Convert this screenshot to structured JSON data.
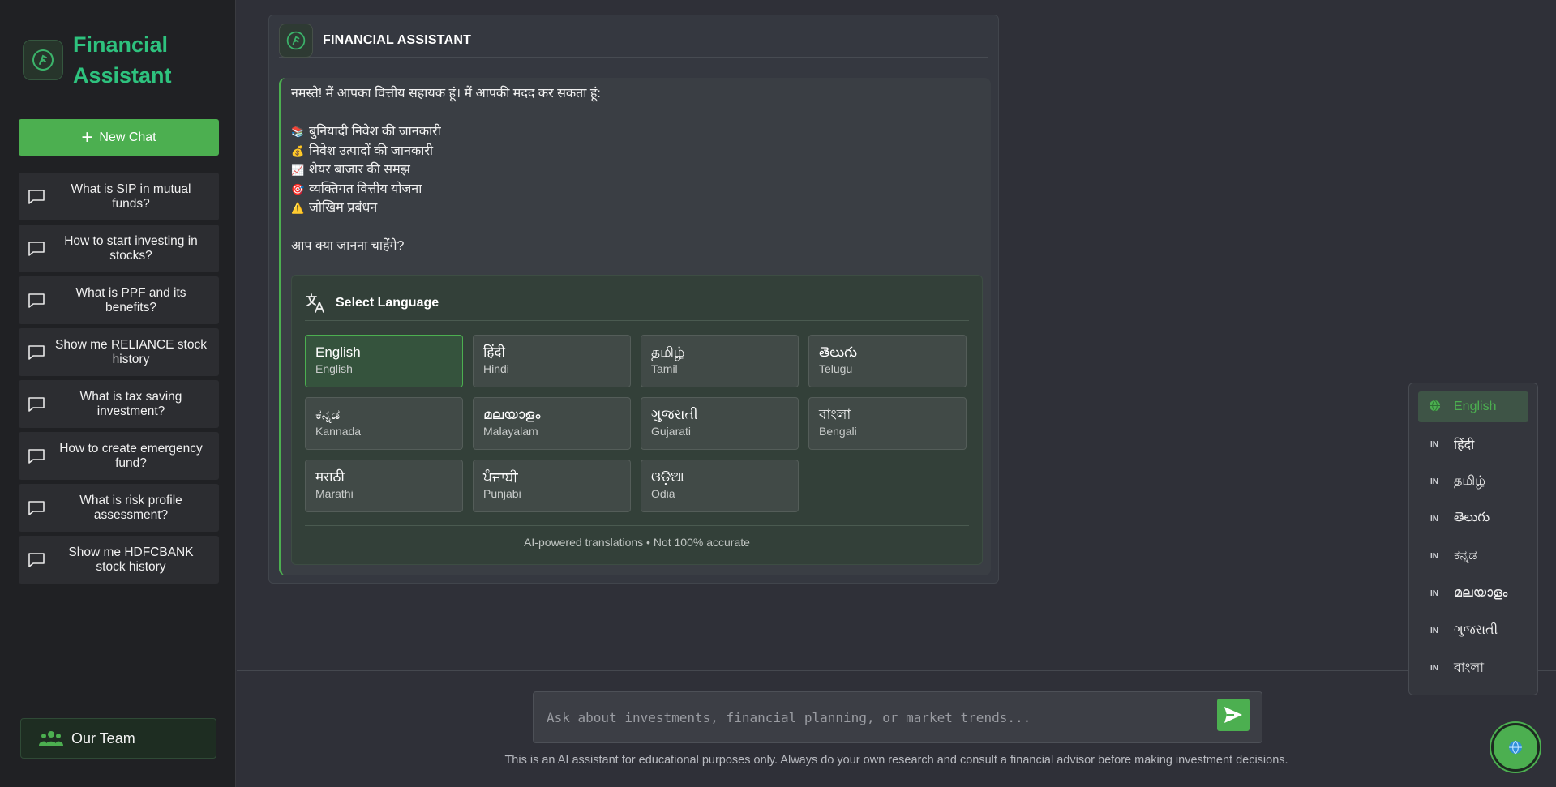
{
  "sidebar": {
    "brand_title": "Financial Assistant",
    "new_chat_label": "New Chat",
    "history": [
      "What is SIP in mutual funds?",
      "How to start investing in stocks?",
      "What is PPF and its benefits?",
      "Show me RELIANCE stock history",
      "What is tax saving investment?",
      "How to create emergency fund?",
      "What is risk profile assessment?",
      "Show me HDFCBANK stock history"
    ],
    "team_label": "Our Team"
  },
  "chat": {
    "header_title": "FINANCIAL ASSISTANT",
    "greeting": "नमस्ते! मैं आपका वित्तीय सहायक हूं। मैं आपकी मदद कर सकता हूं:",
    "bullets": [
      {
        "emoji": "📚",
        "text": "बुनियादी निवेश की जानकारी"
      },
      {
        "emoji": "💰",
        "text": "निवेश उत्पादों की जानकारी"
      },
      {
        "emoji": "📈",
        "text": "शेयर बाजार की समझ"
      },
      {
        "emoji": "🎯",
        "text": "व्यक्तिगत वित्तीय योजना"
      },
      {
        "emoji": "⚠️",
        "text": "जोखिम प्रबंधन"
      }
    ],
    "question": "आप क्या जानना चाहेंगे?"
  },
  "language_panel": {
    "title": "Select Language",
    "languages": [
      {
        "native": "English",
        "english": "English",
        "selected": true
      },
      {
        "native": "हिंदी",
        "english": "Hindi"
      },
      {
        "native": "தமிழ்",
        "english": "Tamil"
      },
      {
        "native": "తెలుగు",
        "english": "Telugu"
      },
      {
        "native": "ಕನ್ನಡ",
        "english": "Kannada"
      },
      {
        "native": "മലയാളം",
        "english": "Malayalam"
      },
      {
        "native": "ગુજરાતી",
        "english": "Gujarati"
      },
      {
        "native": "বাংলা",
        "english": "Bengali"
      },
      {
        "native": "मराठी",
        "english": "Marathi"
      },
      {
        "native": "ਪੰਜਾਬੀ",
        "english": "Punjabi"
      },
      {
        "native": "ଓଡ଼ିଆ",
        "english": "Odia"
      }
    ],
    "footer": "AI-powered translations • Not 100% accurate"
  },
  "input": {
    "placeholder": "Ask about investments, financial planning, or market trends...",
    "disclaimer": "This is an AI assistant for educational purposes only. Always do your own research and consult a financial advisor before making investment decisions."
  },
  "dropdown": {
    "items": [
      {
        "flag": "globe-icon",
        "label": "English",
        "active": true
      },
      {
        "flag": "IN",
        "label": "हिंदी"
      },
      {
        "flag": "IN",
        "label": "தமிழ்"
      },
      {
        "flag": "IN",
        "label": "తెలుగు"
      },
      {
        "flag": "IN",
        "label": "ಕನ್ನಡ"
      },
      {
        "flag": "IN",
        "label": "മലയാളം"
      },
      {
        "flag": "IN",
        "label": "ગુજરાતી"
      },
      {
        "flag": "IN",
        "label": "বাংলা"
      }
    ]
  },
  "colors": {
    "accent": "#4caf50",
    "brand_text": "#2ec27e",
    "sidebar_bg": "#202124",
    "main_bg": "#2f3038"
  }
}
